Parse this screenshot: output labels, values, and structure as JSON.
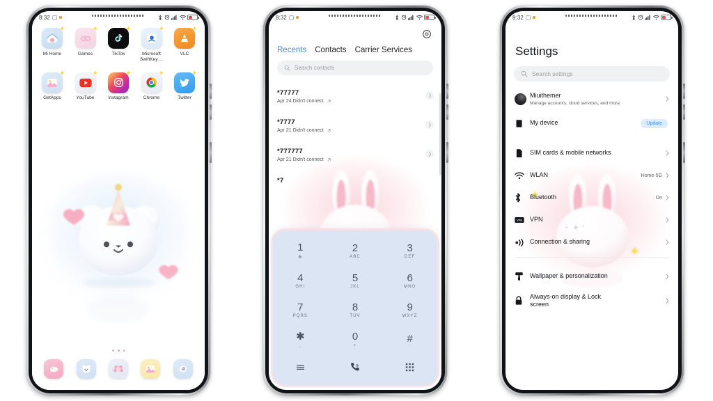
{
  "status_bar": {
    "time": "8:32",
    "icons": [
      "bluetooth-icon",
      "alarm-icon",
      "signal-icon",
      "wifi-icon",
      "battery-icon"
    ]
  },
  "phone1": {
    "name": "home-screen",
    "app_rows": [
      [
        {
          "label": "Mi Home",
          "icon": "mi-home-icon"
        },
        {
          "label": "Games",
          "icon": "games-icon"
        },
        {
          "label": "TikTok",
          "icon": "tiktok-icon"
        },
        {
          "label": "Microsoft\nSwiftKey ...",
          "icon": "swiftkey-icon"
        },
        {
          "label": "VLC",
          "icon": "vlc-icon"
        }
      ],
      [
        {
          "label": "GetApps",
          "icon": "getapps-icon"
        },
        {
          "label": "YouTube",
          "icon": "youtube-icon"
        },
        {
          "label": "Instagram",
          "icon": "instagram-icon"
        },
        {
          "label": "Chrome",
          "icon": "chrome-icon"
        },
        {
          "label": "Twitter",
          "icon": "twitter-icon"
        }
      ]
    ],
    "dock": [
      {
        "icon": "phone-dock-icon"
      },
      {
        "icon": "messages-bear-dock-icon"
      },
      {
        "icon": "gallery-dock-icon"
      },
      {
        "icon": "camera-dock-icon"
      },
      {
        "icon": "browser-dock-icon"
      }
    ],
    "page_indicator": {
      "pages": 3,
      "active": 2
    },
    "wallpaper": "cute-white-bear-party-hat"
  },
  "phone2": {
    "name": "dialer-screen",
    "settings_icon": "gear-icon",
    "tabs": [
      {
        "label": "Recents",
        "active": true
      },
      {
        "label": "Contacts",
        "active": false
      },
      {
        "label": "Carrier Services",
        "active": false
      }
    ],
    "search_placeholder": "Search contacts",
    "calls": [
      {
        "number": "*77777",
        "detail": "Apr 24 Didn't connect"
      },
      {
        "number": "*7777",
        "detail": "Apr 21 Didn't connect"
      },
      {
        "number": "*777777",
        "detail": "Apr 21 Didn't connect"
      },
      {
        "number": "*7",
        "detail": ""
      }
    ],
    "keypad": {
      "keys": [
        {
          "digit": "1",
          "letters": "☸"
        },
        {
          "digit": "2",
          "letters": "ABC"
        },
        {
          "digit": "3",
          "letters": "DEF"
        },
        {
          "digit": "4",
          "letters": "GHI"
        },
        {
          "digit": "5",
          "letters": "JKL"
        },
        {
          "digit": "6",
          "letters": "MNO"
        },
        {
          "digit": "7",
          "letters": "PQRS"
        },
        {
          "digit": "8",
          "letters": "TUV"
        },
        {
          "digit": "9",
          "letters": "WXYZ"
        },
        {
          "digit": "✱",
          "letters": ","
        },
        {
          "digit": "0",
          "letters": "+"
        },
        {
          "digit": "#",
          "letters": ""
        }
      ],
      "actions": [
        {
          "icon": "menu-icon"
        },
        {
          "icon": "call-icon"
        },
        {
          "icon": "keypad-grid-icon"
        }
      ],
      "background_color": "#dbe5f4"
    }
  },
  "phone3": {
    "name": "settings-screen",
    "title": "Settings",
    "search_placeholder": "Search settings",
    "account": {
      "name": "Miuithemer",
      "subtitle": "Manage accounts, cloud services, and more",
      "icon": "avatar"
    },
    "items": [
      {
        "label": "My device",
        "icon": "device-icon",
        "badge": "Update",
        "value": "",
        "chevron": false
      },
      {
        "label": "SIM cards & mobile networks",
        "icon": "sim-card-icon",
        "value": "",
        "chevron": true
      },
      {
        "label": "WLAN",
        "icon": "wifi-icon",
        "value": "Home-5G",
        "chevron": true
      },
      {
        "label": "Bluetooth",
        "icon": "bluetooth-icon",
        "value": "On",
        "chevron": true
      },
      {
        "label": "VPN",
        "icon": "vpn-icon",
        "value": "",
        "chevron": true
      },
      {
        "label": "Connection & sharing",
        "icon": "connection-sharing-icon",
        "value": "",
        "chevron": true
      },
      {
        "label": "Wallpaper & personalization",
        "icon": "wallpaper-icon",
        "value": "",
        "chevron": true
      },
      {
        "label": "Always-on display & Lock screen",
        "icon": "lock-icon",
        "value": "",
        "chevron": true
      }
    ],
    "accent_color": "#3d8bf2",
    "badge_bg": "#dcebfd"
  }
}
